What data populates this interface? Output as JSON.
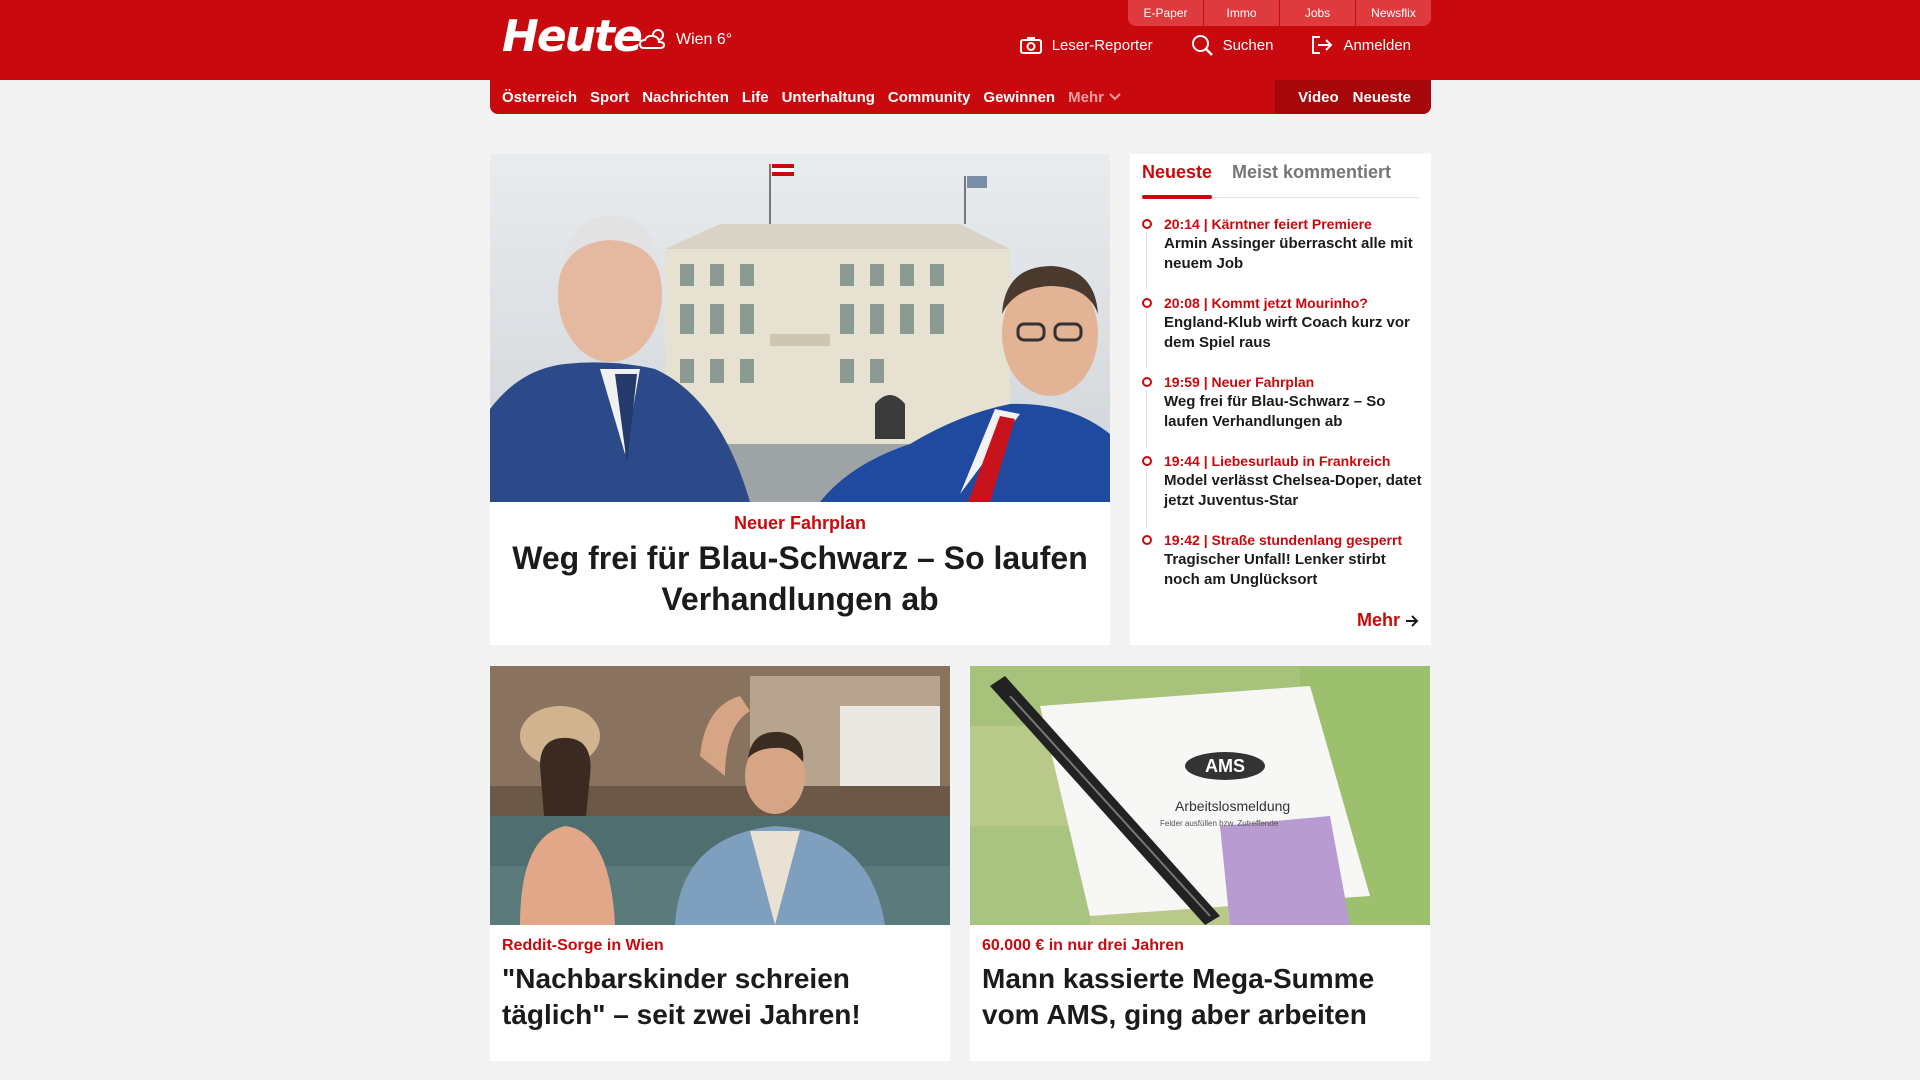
{
  "header": {
    "logo": "Heute",
    "weather": {
      "icon": "cloud-sun-icon",
      "label": "Wien 6°"
    },
    "topbar": [
      "E-Paper",
      "Immo",
      "Jobs",
      "Newsflix"
    ],
    "tools": [
      {
        "label": "Leser-Reporter",
        "icon": "camera-icon"
      },
      {
        "label": "Suchen",
        "icon": "search-icon"
      },
      {
        "label": "Anmelden",
        "icon": "login-icon"
      }
    ]
  },
  "nav": {
    "items": [
      "Österreich",
      "Sport",
      "Nachrichten",
      "Life",
      "Unterhaltung",
      "Community",
      "Gewinnen"
    ],
    "more": "Mehr",
    "right": [
      "Video",
      "Neueste"
    ]
  },
  "hero": {
    "kicker": "Neuer Fahrplan",
    "title": "Weg frei für Blau-Schwarz – So laufen Verhandlungen ab"
  },
  "sidebar": {
    "tabs": [
      "Neueste",
      "Meist kommentiert"
    ],
    "news": [
      {
        "time": "20:14",
        "kicker": "Kärntner feiert Premiere",
        "title": "Armin Assinger überrascht alle mit neuem Job"
      },
      {
        "time": "20:08",
        "kicker": "Kommt jetzt Mourinho?",
        "title": "England-Klub wirft Coach kurz vor dem Spiel raus"
      },
      {
        "time": "19:59",
        "kicker": "Neuer Fahrplan",
        "title": "Weg frei für Blau-Schwarz – So laufen Verhandlungen ab"
      },
      {
        "time": "19:44",
        "kicker": "Liebesurlaub in Frankreich",
        "title": "Model verlässt Chelsea-Doper, datet jetzt Juventus-Star"
      },
      {
        "time": "19:42",
        "kicker": "Straße stundenlang gesperrt",
        "title": "Tragischer Unfall! Lenker stirbt noch am Unglücksort"
      }
    ],
    "more": "Mehr"
  },
  "cards": [
    {
      "kicker": "Reddit-Sorge in Wien",
      "title": "\"Nachbarskinder schreien täglich\" – seit zwei Jahren!"
    },
    {
      "kicker": "60.000 € in nur drei Jahren",
      "title": "Mann kassierte Mega-Summe vom AMS, ging aber arbeiten",
      "image_text": {
        "logo": "AMS",
        "form": "Arbeitslosmeldung",
        "note": "Felder ausfüllen bzw. Zutreffende"
      }
    }
  ],
  "colors": {
    "brand": "#c8090e",
    "brand_dark": "#a5070b",
    "topbar": "#df3a3e",
    "page_bg": "#f3f3f3"
  }
}
